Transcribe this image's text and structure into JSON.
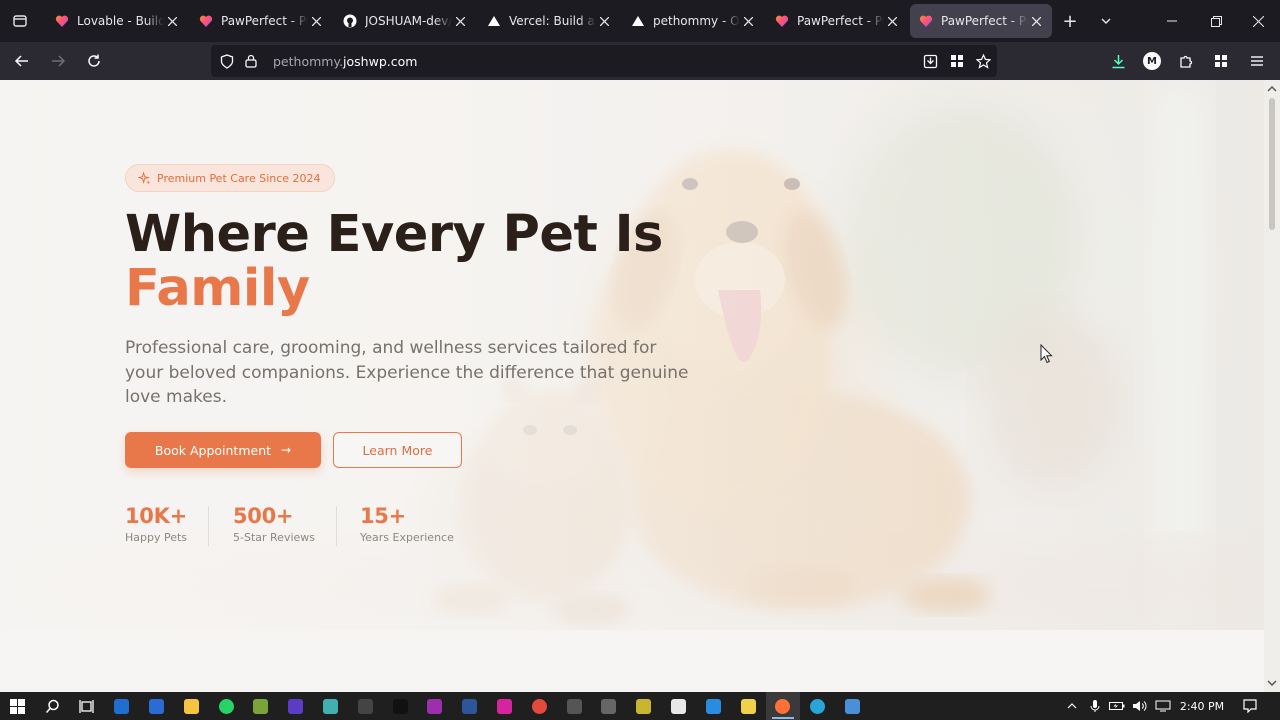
{
  "browser": {
    "tabs": [
      {
        "title": "Lovable - Build fo",
        "favicon": "lovable-heart-icon",
        "color": "#ff4f7a",
        "active": false
      },
      {
        "title": "PawPerfect - Prem",
        "favicon": "lovable-heart-icon",
        "color": "#ff4f7a",
        "active": false
      },
      {
        "title": "JOSHUAM-dev/pe",
        "favicon": "github-icon",
        "color": "#ffffff",
        "active": false
      },
      {
        "title": "Vercel: Build and d",
        "favicon": "vercel-triangle-icon",
        "color": "#ffffff",
        "active": false
      },
      {
        "title": "pethommy - Over",
        "favicon": "vercel-triangle-icon",
        "color": "#ffffff",
        "active": false
      },
      {
        "title": "PawPerfect - Prem",
        "favicon": "lovable-heart-icon",
        "color": "#ff4f7a",
        "active": false
      },
      {
        "title": "PawPerfect - Prem",
        "favicon": "lovable-heart-icon",
        "color": "#ff4f7a",
        "active": true
      }
    ],
    "url": {
      "subdomain": "pethommy.",
      "domain": "joshwp.com"
    },
    "profile_initial": "M"
  },
  "hero": {
    "badge": "Premium Pet Care Since 2024",
    "headline_line1": "Where Every Pet Is",
    "headline_line2": "Family",
    "lead": "Professional care, grooming, and wellness services tailored for your beloved companions. Experience the difference that genuine love makes.",
    "primary_button": "Book Appointment",
    "primary_button_arrow": "→",
    "secondary_button": "Learn More",
    "stats": [
      {
        "value": "10K+",
        "label": "Happy Pets"
      },
      {
        "value": "500+",
        "label": "5-Star Reviews"
      },
      {
        "value": "15+",
        "label": "Years Experience"
      }
    ],
    "accent_color": "#e8784a"
  },
  "taskbar": {
    "time": "2:40 PM",
    "apps": [
      {
        "name": "outlook-icon",
        "color": "#1f6fd1"
      },
      {
        "name": "photoshop-icon",
        "color": "#2b6cd4"
      },
      {
        "name": "file-explorer-icon",
        "color": "#f4c542"
      },
      {
        "name": "whatsapp-icon",
        "color": "#25d366"
      },
      {
        "name": "app-icon",
        "color": "#7aa33a"
      },
      {
        "name": "app-icon",
        "color": "#5b3cc4"
      },
      {
        "name": "app-icon",
        "color": "#43b0b0"
      },
      {
        "name": "terminal-icon",
        "color": "#444444"
      },
      {
        "name": "tiktok-icon",
        "color": "#111111"
      },
      {
        "name": "app-icon",
        "color": "#9b2fae"
      },
      {
        "name": "word-icon",
        "color": "#2b579a"
      },
      {
        "name": "instagram-icon",
        "color": "#d6249f"
      },
      {
        "name": "chrome-icon",
        "color": "#e24a3b"
      },
      {
        "name": "calculator-icon",
        "color": "#555555"
      },
      {
        "name": "app-icon",
        "color": "#666666"
      },
      {
        "name": "app-icon",
        "color": "#c8b630"
      },
      {
        "name": "notepad-icon",
        "color": "#e8e8e8"
      },
      {
        "name": "vscode-icon",
        "color": "#2a8ce0"
      },
      {
        "name": "notes-icon",
        "color": "#f0d14a"
      },
      {
        "name": "firefox-icon",
        "color": "#ff7139"
      },
      {
        "name": "edge-icon",
        "color": "#28a4d8"
      },
      {
        "name": "app-icon",
        "color": "#4a90d9"
      }
    ]
  }
}
